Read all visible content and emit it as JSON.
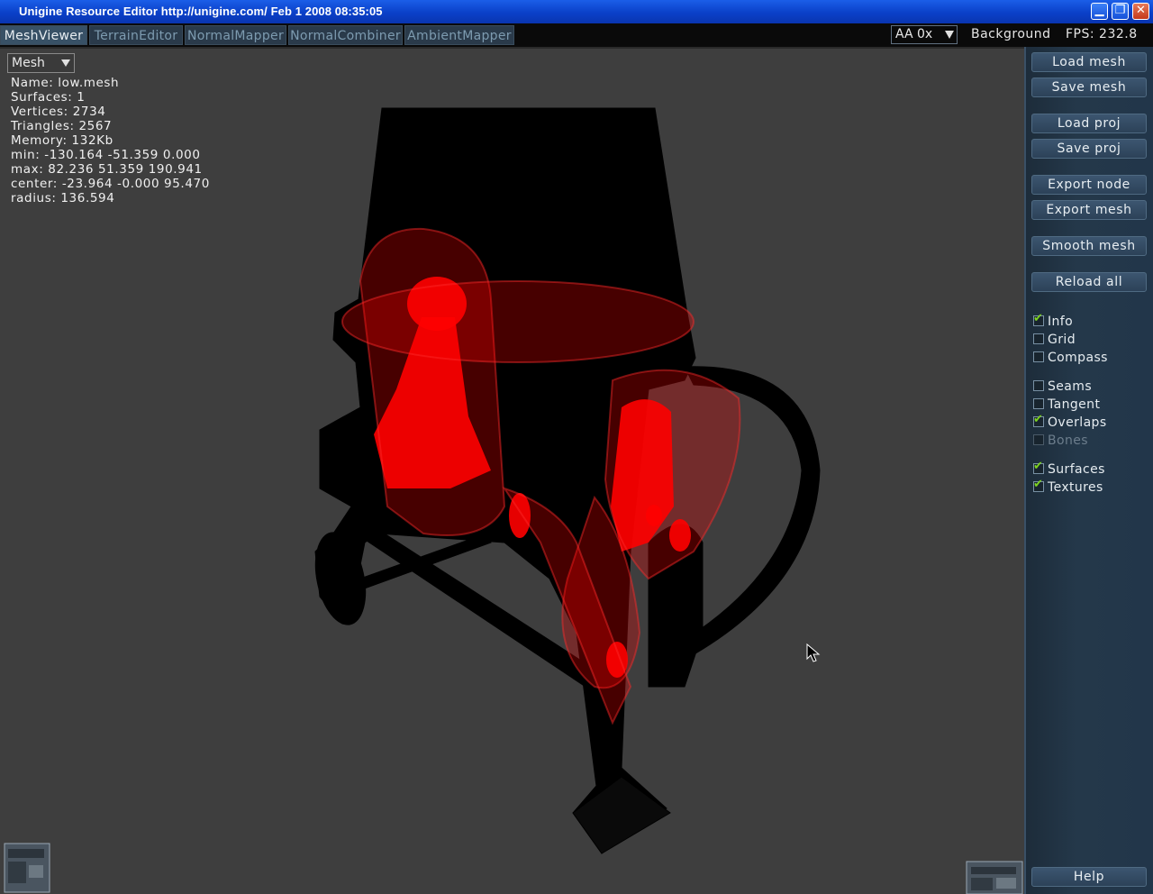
{
  "window": {
    "title": "Unigine Resource Editor http://unigine.com/ Feb  1 2008 08:35:05",
    "minimize_glyph": "▁",
    "maximize_glyph": "❐",
    "close_glyph": "✕"
  },
  "tabs": [
    {
      "label": "MeshViewer",
      "active": true
    },
    {
      "label": "TerrainEditor",
      "active": false
    },
    {
      "label": "NormalMapper",
      "active": false
    },
    {
      "label": "NormalCombiner",
      "active": false
    },
    {
      "label": "AmbientMapper",
      "active": false
    }
  ],
  "header": {
    "aa_value": "AA  0x",
    "background_label": "Background",
    "fps_label": "FPS:  232.8"
  },
  "viewport": {
    "mode_select": "Mesh",
    "info": [
      "Name:  low.mesh",
      "Surfaces:  1",
      "Vertices:  2734",
      "Triangles:  2567",
      "Memory:  132Kb",
      "min:  -130.164  -51.359  0.000",
      "max:  82.236  51.359  190.941",
      "center:  -23.964  -0.000  95.470",
      "radius:  136.594"
    ],
    "background_color": "#3e3e3e",
    "overlay_color": "#ff0000"
  },
  "panel": {
    "buttons": [
      "Load  mesh",
      "Save  mesh",
      "Load  proj",
      "Save  proj",
      "Export  node",
      "Export  mesh",
      "Smooth  mesh",
      "Reload  all"
    ],
    "checkboxes": [
      {
        "label": "Info",
        "checked": true,
        "enabled": true
      },
      {
        "label": "Grid",
        "checked": false,
        "enabled": true
      },
      {
        "label": "Compass",
        "checked": false,
        "enabled": true
      },
      {
        "label": "Seams",
        "checked": false,
        "enabled": true
      },
      {
        "label": "Tangent",
        "checked": false,
        "enabled": true
      },
      {
        "label": "Overlaps",
        "checked": true,
        "enabled": true
      },
      {
        "label": "Bones",
        "checked": false,
        "enabled": false
      },
      {
        "label": "Surfaces",
        "checked": true,
        "enabled": true
      },
      {
        "label": "Textures",
        "checked": true,
        "enabled": true
      }
    ],
    "help_label": "Help"
  }
}
